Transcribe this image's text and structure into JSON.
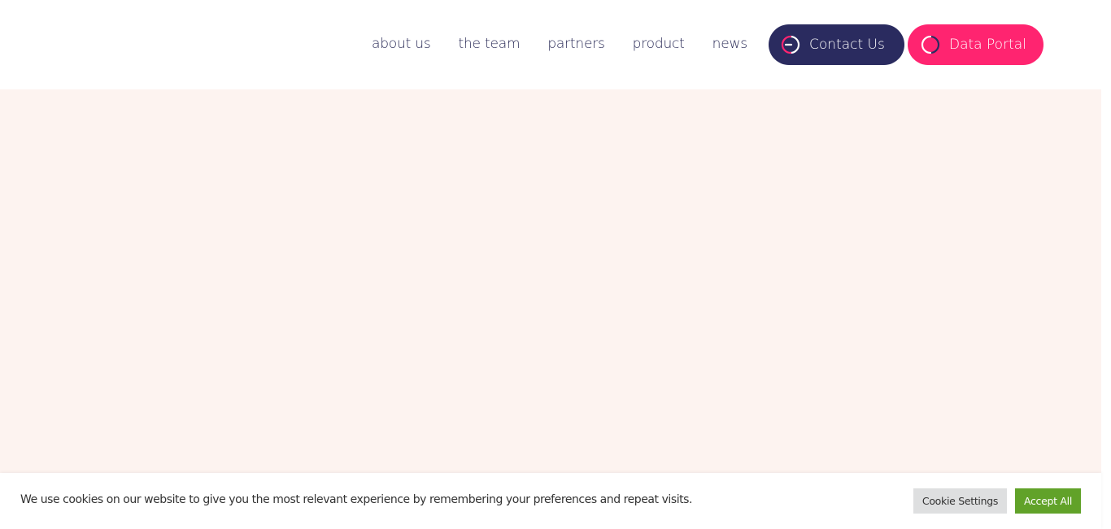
{
  "nav": {
    "items": [
      {
        "label": "about us"
      },
      {
        "label": "the team"
      },
      {
        "label": "partners"
      },
      {
        "label": "product"
      },
      {
        "label": "news"
      }
    ]
  },
  "buttons": {
    "contact": {
      "label": "Contact Us",
      "icon": "power-icon",
      "color": "#2a2b5f"
    },
    "portal": {
      "label": "Data Portal",
      "icon": "power-icon",
      "color": "#ff2470"
    }
  },
  "colors": {
    "nav_text": "#2a2b57",
    "hero_bg": "#fdf3f0",
    "accent_pink": "#ff2470",
    "accent_navy": "#2a2b5f",
    "accept_green": "#61a229"
  },
  "cookie": {
    "text": "We use cookies on our website to give you the most relevant experience by remembering your preferences and repeat visits.",
    "settings_label": "Cookie Settings",
    "accept_label": "Accept All"
  }
}
